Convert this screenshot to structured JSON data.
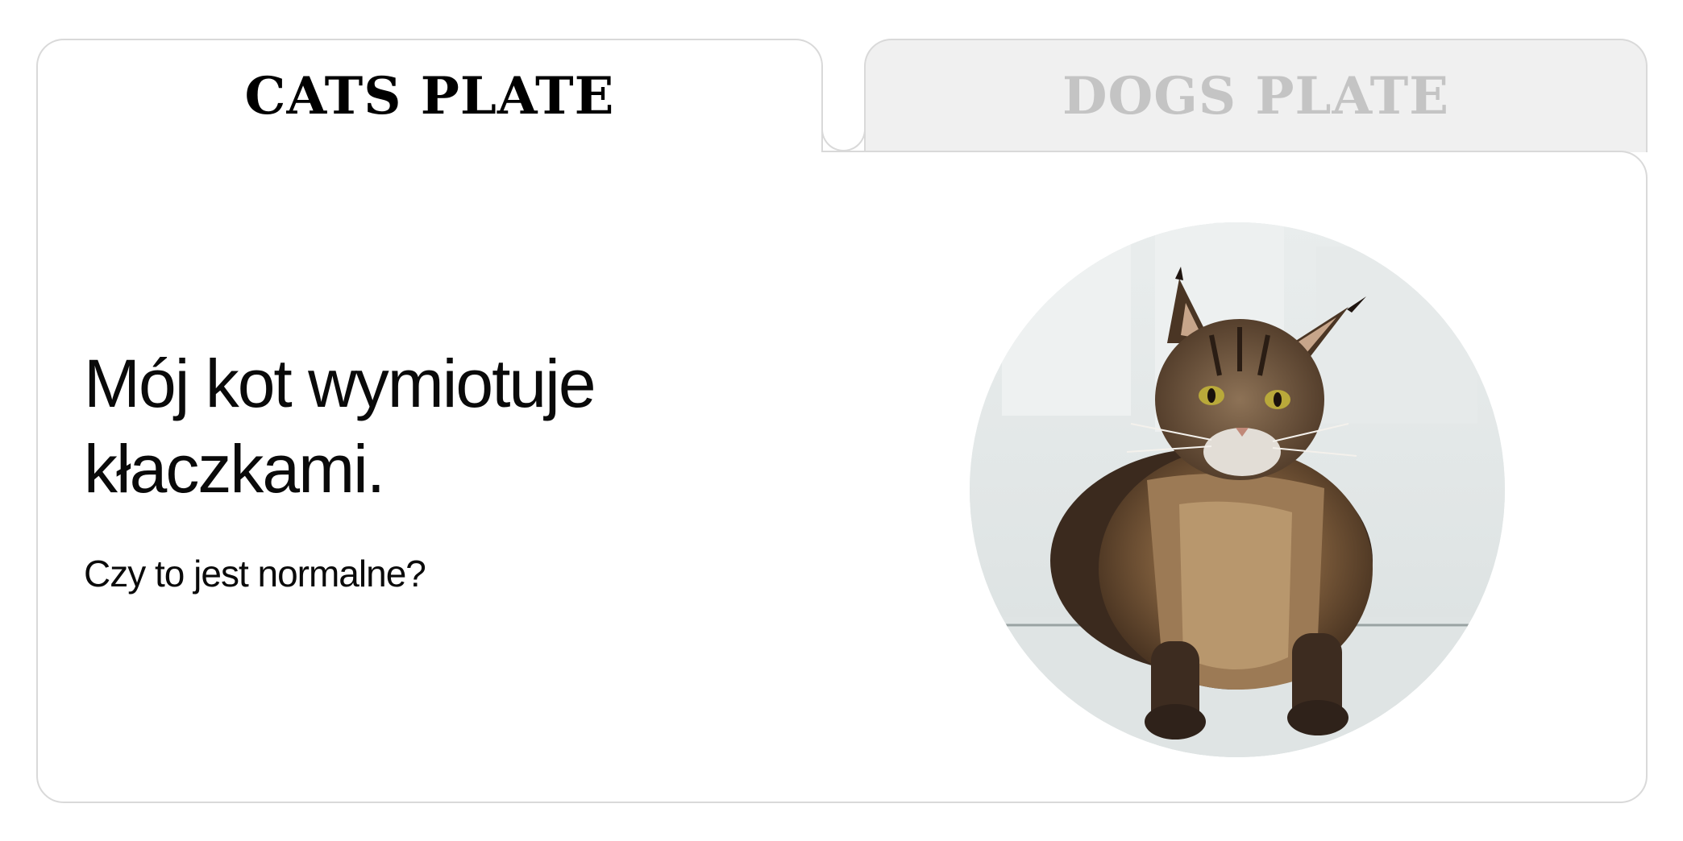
{
  "tabs": {
    "active": "cats",
    "cats_label": "CATS PLATE",
    "dogs_label": "DOGS PLATE"
  },
  "content": {
    "headline_line1": "Mój kot wymiotuje",
    "headline_line2": "kłaczkami.",
    "subtitle": "Czy to jest normalne?"
  },
  "image": {
    "subject": "maine-coon-cat-photo"
  },
  "colors": {
    "border": "#d9d9d9",
    "inactive_tab_bg": "#f0f0f0",
    "inactive_tab_text": "#c4c4c4",
    "text": "#0a0a0a"
  }
}
